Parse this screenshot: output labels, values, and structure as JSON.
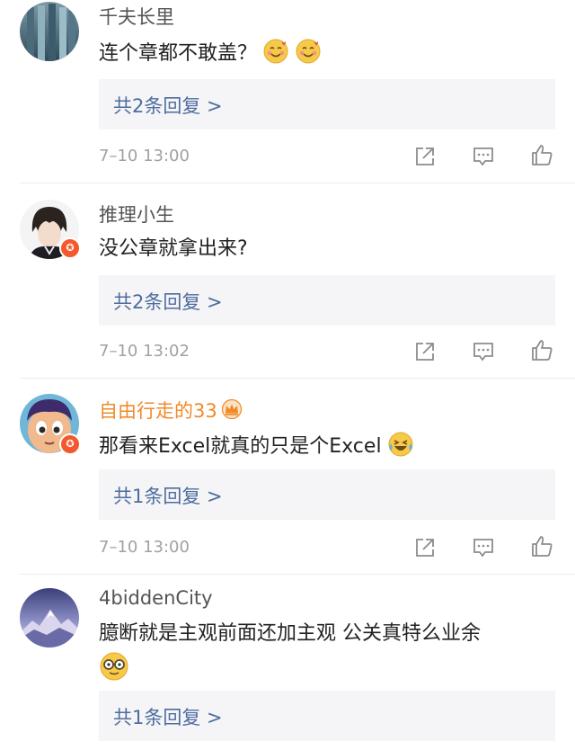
{
  "comments": [
    {
      "username": "千夫长里",
      "text": "连个章都不敢盖？",
      "emojis": [
        "smiling-face-with-hearts-icon",
        "smiling-face-with-hearts-icon"
      ],
      "reply_summary": "共2条回复 >",
      "time": "7–10 13:00",
      "verified": false,
      "vip": false
    },
    {
      "username": "推理小生",
      "text": "没公章就拿出来?",
      "emojis": [],
      "reply_summary": "共2条回复 >",
      "time": "7–10 13:02",
      "verified": true,
      "vip": false
    },
    {
      "username": "自由行走的33",
      "text": "那看来Excel就真的只是个Excel",
      "emojis": [
        "laughing-crying-icon"
      ],
      "reply_summary": "共1条回复 >",
      "time": "7–10 13:00",
      "verified": true,
      "vip": true,
      "username_color": "#f08a2a"
    },
    {
      "username": "4biddenCity",
      "text": "臆断就是主观前面还加主观 公关真特么业余",
      "emojis": [
        "nerd-face-glasses-icon"
      ],
      "reply_summary": "共1条回复 >",
      "time": "",
      "verified": false,
      "vip": false
    }
  ],
  "colors": {
    "reply_link": "#4e6d9e",
    "verified_badge": "#f5582d",
    "meta_text": "#a1a1a1"
  }
}
